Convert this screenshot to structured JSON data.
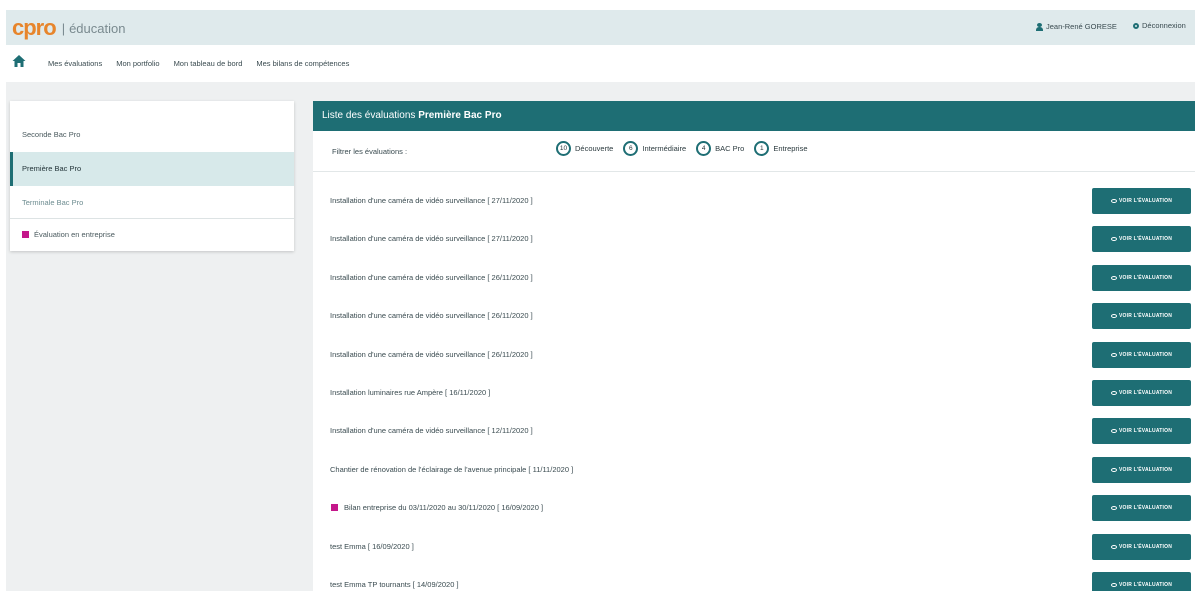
{
  "brand": {
    "logo_main": "cpro",
    "logo_section": "éducation"
  },
  "header": {
    "user_name": "Jean-René GORESE",
    "logout_label": "Déconnexion"
  },
  "nav": {
    "items": [
      "Mes évaluations",
      "Mon portfolio",
      "Mon tableau de bord",
      "Mes bilans de compétences"
    ]
  },
  "sidebar": {
    "items": [
      {
        "label": "Seconde Bac Pro"
      },
      {
        "label": "Première Bac Pro"
      },
      {
        "label": "Terminale Bac Pro"
      }
    ],
    "legend": "Évaluation en entreprise"
  },
  "panel": {
    "title_prefix": "Liste des évaluations",
    "title_bold": "Première Bac Pro",
    "filter_label": "Filtrer les évaluations :",
    "filters": [
      {
        "count": "10",
        "label": "Découverte"
      },
      {
        "count": "6",
        "label": "Intermédiaire"
      },
      {
        "count": "4",
        "label": "BAC Pro"
      },
      {
        "count": "1",
        "label": "Entreprise"
      }
    ],
    "view_button_label": "VOIR L'ÉVALUATION",
    "evaluations": [
      {
        "title": "Installation d'une caméra de vidéo surveillance [ 27/11/2020 ]",
        "entreprise": false
      },
      {
        "title": "Installation d'une caméra de vidéo surveillance [ 27/11/2020 ]",
        "entreprise": false
      },
      {
        "title": "Installation d'une caméra de vidéo surveillance [ 26/11/2020 ]",
        "entreprise": false
      },
      {
        "title": "Installation d'une caméra de vidéo surveillance [ 26/11/2020 ]",
        "entreprise": false
      },
      {
        "title": "Installation d'une caméra de vidéo surveillance [ 26/11/2020 ]",
        "entreprise": false
      },
      {
        "title": "Installation luminaires rue Ampère [ 16/11/2020 ]",
        "entreprise": false
      },
      {
        "title": "Installation d'une caméra de vidéo surveillance [ 12/11/2020 ]",
        "entreprise": false
      },
      {
        "title": "Chantier de rénovation de l'éclairage de l'avenue principale [ 11/11/2020 ]",
        "entreprise": false
      },
      {
        "title": "Bilan entreprise du 03/11/2020 au 30/11/2020 [ 16/09/2020 ]",
        "entreprise": true
      },
      {
        "title": "test Emma [ 16/09/2020 ]",
        "entreprise": false
      },
      {
        "title": "test Emma TP tournants [ 14/09/2020 ]",
        "entreprise": false
      }
    ]
  },
  "colors": {
    "accent": "#1e6e74",
    "brand": "#e7852b",
    "entreprise": "#c4178a"
  }
}
